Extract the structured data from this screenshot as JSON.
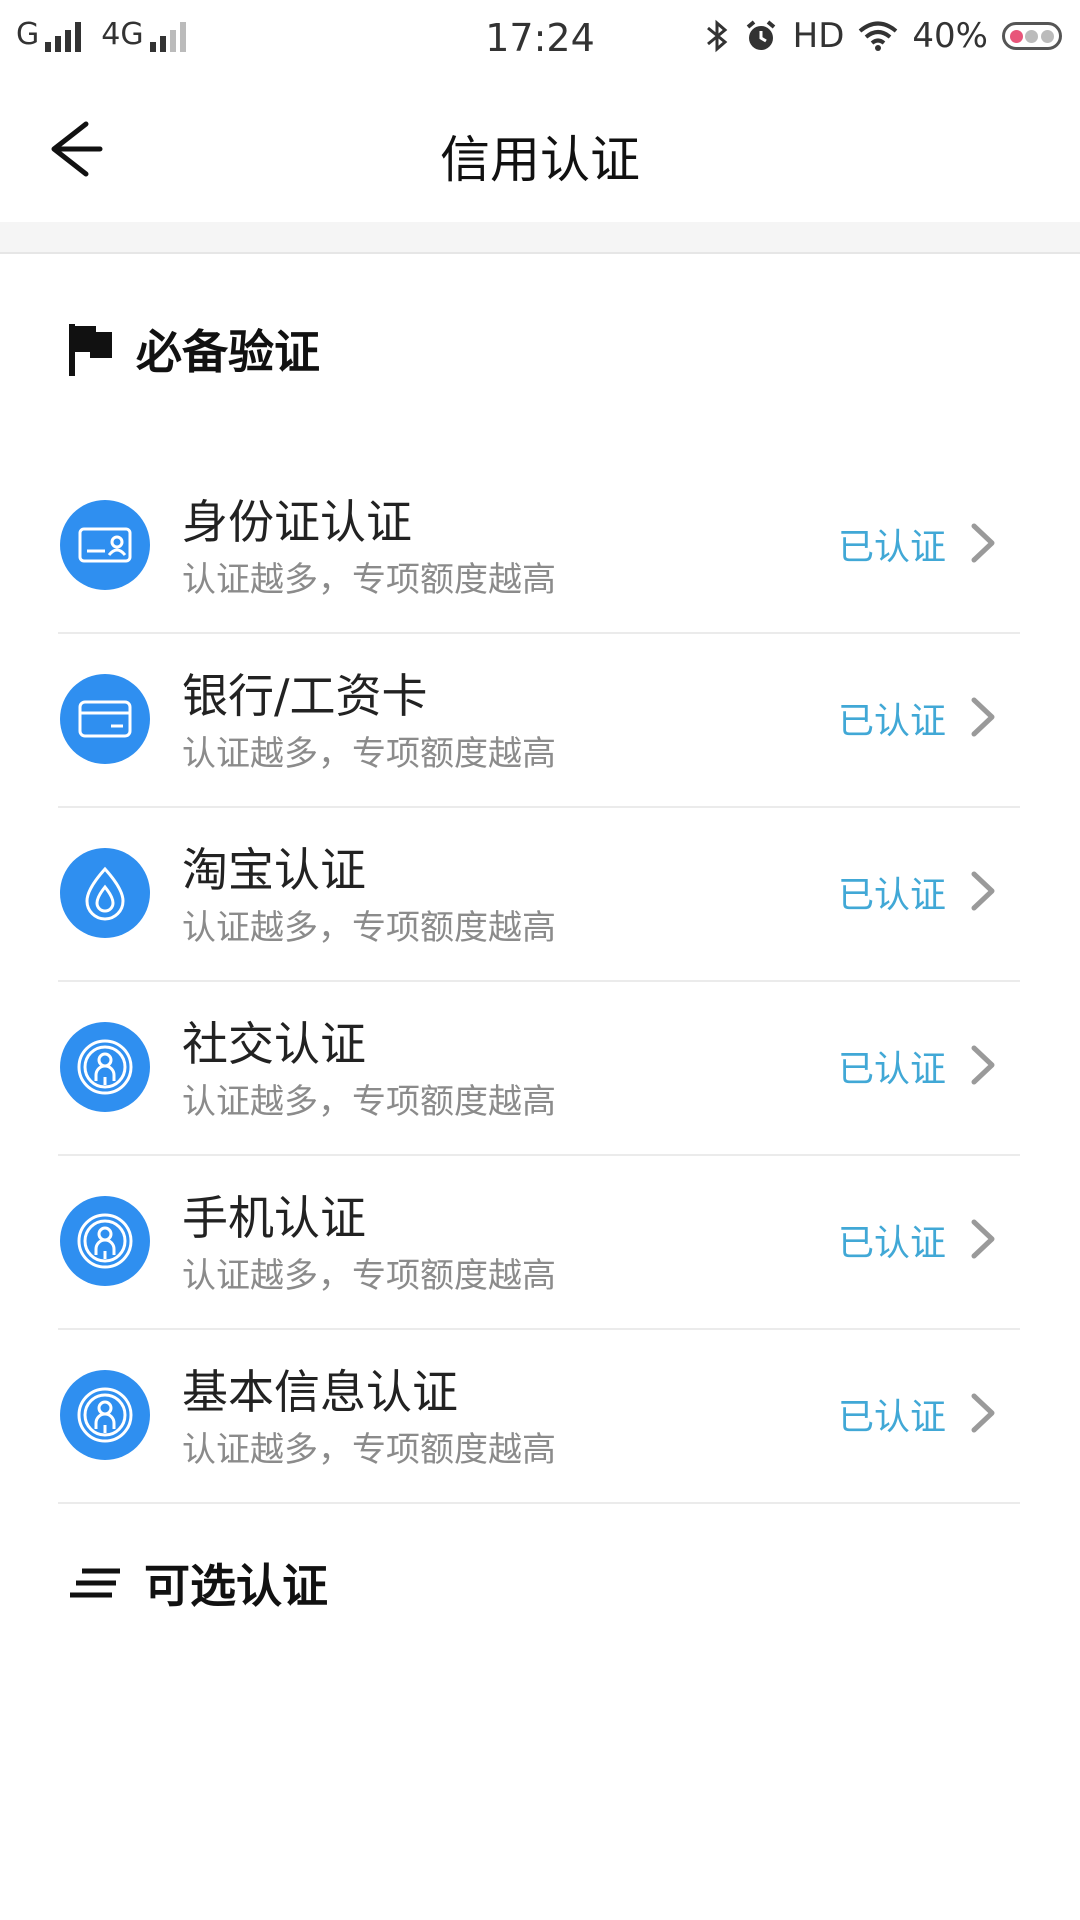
{
  "status_bar": {
    "carrier": "G",
    "network": "4G",
    "time": "17:24",
    "hd": "HD",
    "battery": "40%"
  },
  "nav": {
    "title": "信用认证"
  },
  "required_section": {
    "label": "必备验证",
    "icon": "flag-icon"
  },
  "items": [
    {
      "title": "身份证认证",
      "subtitle": "认证越多，专项额度越高",
      "status": "已认证",
      "icon": "id-card-icon"
    },
    {
      "title": "银行/工资卡",
      "subtitle": "认证越多，专项额度越高",
      "status": "已认证",
      "icon": "bank-card-icon"
    },
    {
      "title": "淘宝认证",
      "subtitle": "认证越多，专项额度越高",
      "status": "已认证",
      "icon": "drop-icon"
    },
    {
      "title": "社交认证",
      "subtitle": "认证越多，专项额度越高",
      "status": "已认证",
      "icon": "person-badge-icon"
    },
    {
      "title": "手机认证",
      "subtitle": "认证越多，专项额度越高",
      "status": "已认证",
      "icon": "person-badge-icon"
    },
    {
      "title": "基本信息认证",
      "subtitle": "认证越多，专项额度越高",
      "status": "已认证",
      "icon": "person-badge-icon"
    }
  ],
  "optional_section": {
    "label": "可选认证",
    "icon": "list-lines-icon"
  },
  "colors": {
    "accent": "#2f8ff0",
    "status_text": "#41a8d6"
  }
}
